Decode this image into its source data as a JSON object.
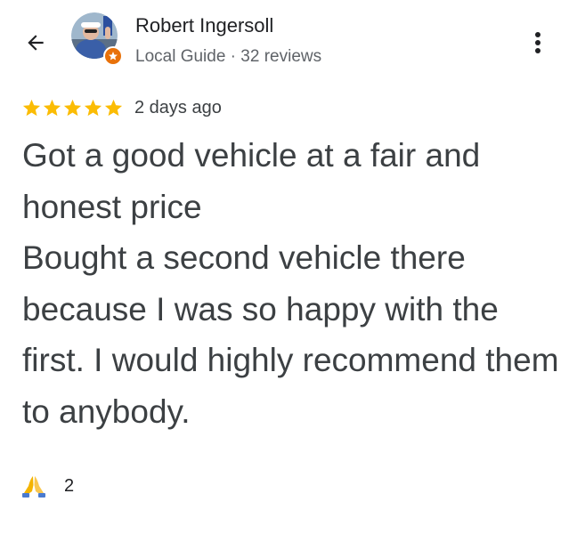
{
  "header": {
    "back_icon": "arrow-back-icon",
    "more_icon": "more-vert-icon"
  },
  "reviewer": {
    "name": "Robert Ingersoll",
    "meta": "Local Guide · 32 reviews",
    "avatar_icon": "avatar",
    "badge_icon": "local-guide-badge-icon",
    "badge_color": "#e8710a"
  },
  "review": {
    "rating": 5,
    "max_rating": 5,
    "star_color": "#fbbc04",
    "date": "2 days ago",
    "text": "Got a good vehicle at a fair and honest price\nBought a second vehicle there because I was so happy with the first.  I would highly recommend them to anybody."
  },
  "reaction": {
    "icon": "folded-hands-icon",
    "count": "2"
  }
}
